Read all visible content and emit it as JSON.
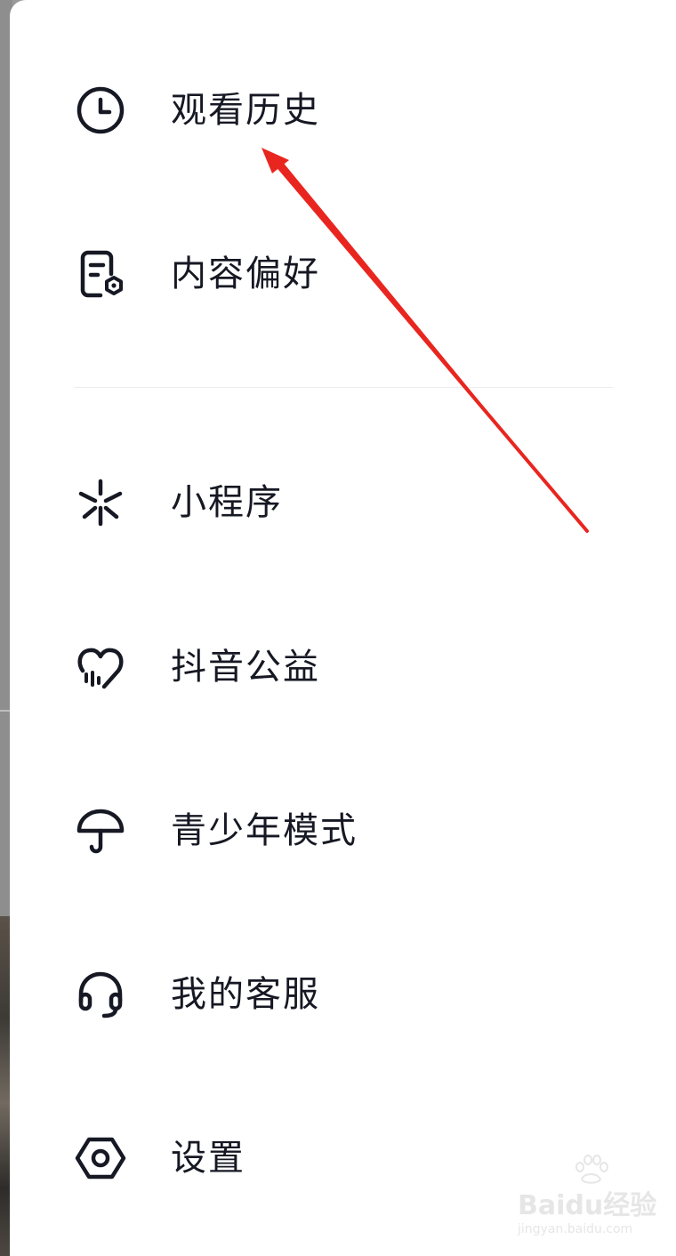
{
  "menu": {
    "items": [
      {
        "label": "观看历史",
        "icon": "clock-icon"
      },
      {
        "label": "内容偏好",
        "icon": "document-settings-icon"
      },
      {
        "label": "小程序",
        "icon": "mini-program-icon"
      },
      {
        "label": "抖音公益",
        "icon": "charity-heart-icon"
      },
      {
        "label": "青少年模式",
        "icon": "umbrella-icon"
      },
      {
        "label": "我的客服",
        "icon": "headset-icon"
      },
      {
        "label": "设置",
        "icon": "hexagon-settings-icon"
      }
    ]
  },
  "watermark": {
    "title": "Baidu经验",
    "url": "jingyan.baidu.com"
  },
  "colors": {
    "text": "#161823",
    "annotation_arrow": "#e8261f",
    "background": "#ffffff"
  }
}
